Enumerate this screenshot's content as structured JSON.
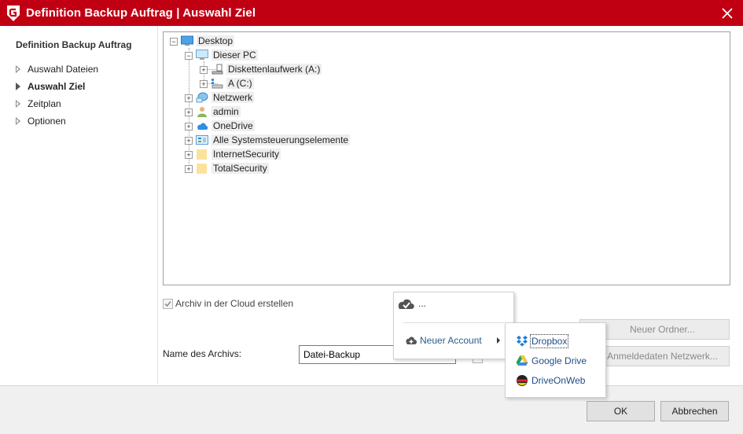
{
  "window": {
    "title": "Definition Backup Auftrag | Auswahl Ziel"
  },
  "sidebar": {
    "heading": "Definition Backup Auftrag",
    "items": [
      {
        "label": "Auswahl Dateien",
        "active": false
      },
      {
        "label": "Auswahl Ziel",
        "active": true
      },
      {
        "label": "Zeitplan",
        "active": false
      },
      {
        "label": "Optionen",
        "active": false
      }
    ]
  },
  "tree": {
    "desktop": "Desktop",
    "this_pc": "Dieser PC",
    "floppy": "Diskettenlaufwerk (A:)",
    "drive_c": "A (C:)",
    "network": "Netzwerk",
    "admin": "admin",
    "onedrive": "OneDrive",
    "control_panel": "Alle Systemsteuerungselemente",
    "internet_security": "InternetSecurity",
    "total_security": "TotalSecurity"
  },
  "cloud_checkbox": {
    "label": "Archiv in der Cloud erstellen",
    "checked": true
  },
  "archive_name": {
    "label": "Name des Archivs:",
    "value": "Datei-Backup"
  },
  "buttons": {
    "new_folder": "Neuer Ordner...",
    "network_credentials": "Anmeldedaten Netzwerk...",
    "ok": "OK",
    "cancel": "Abbrechen"
  },
  "cloud_menu": {
    "current": "...",
    "new_account": "Neuer Account",
    "providers": [
      "Dropbox",
      "Google Drive",
      "DriveOnWeb"
    ]
  },
  "colors": {
    "titlebar": "#c00012",
    "menu_text": "#2a5d8c",
    "folder": "#fbe29c"
  }
}
